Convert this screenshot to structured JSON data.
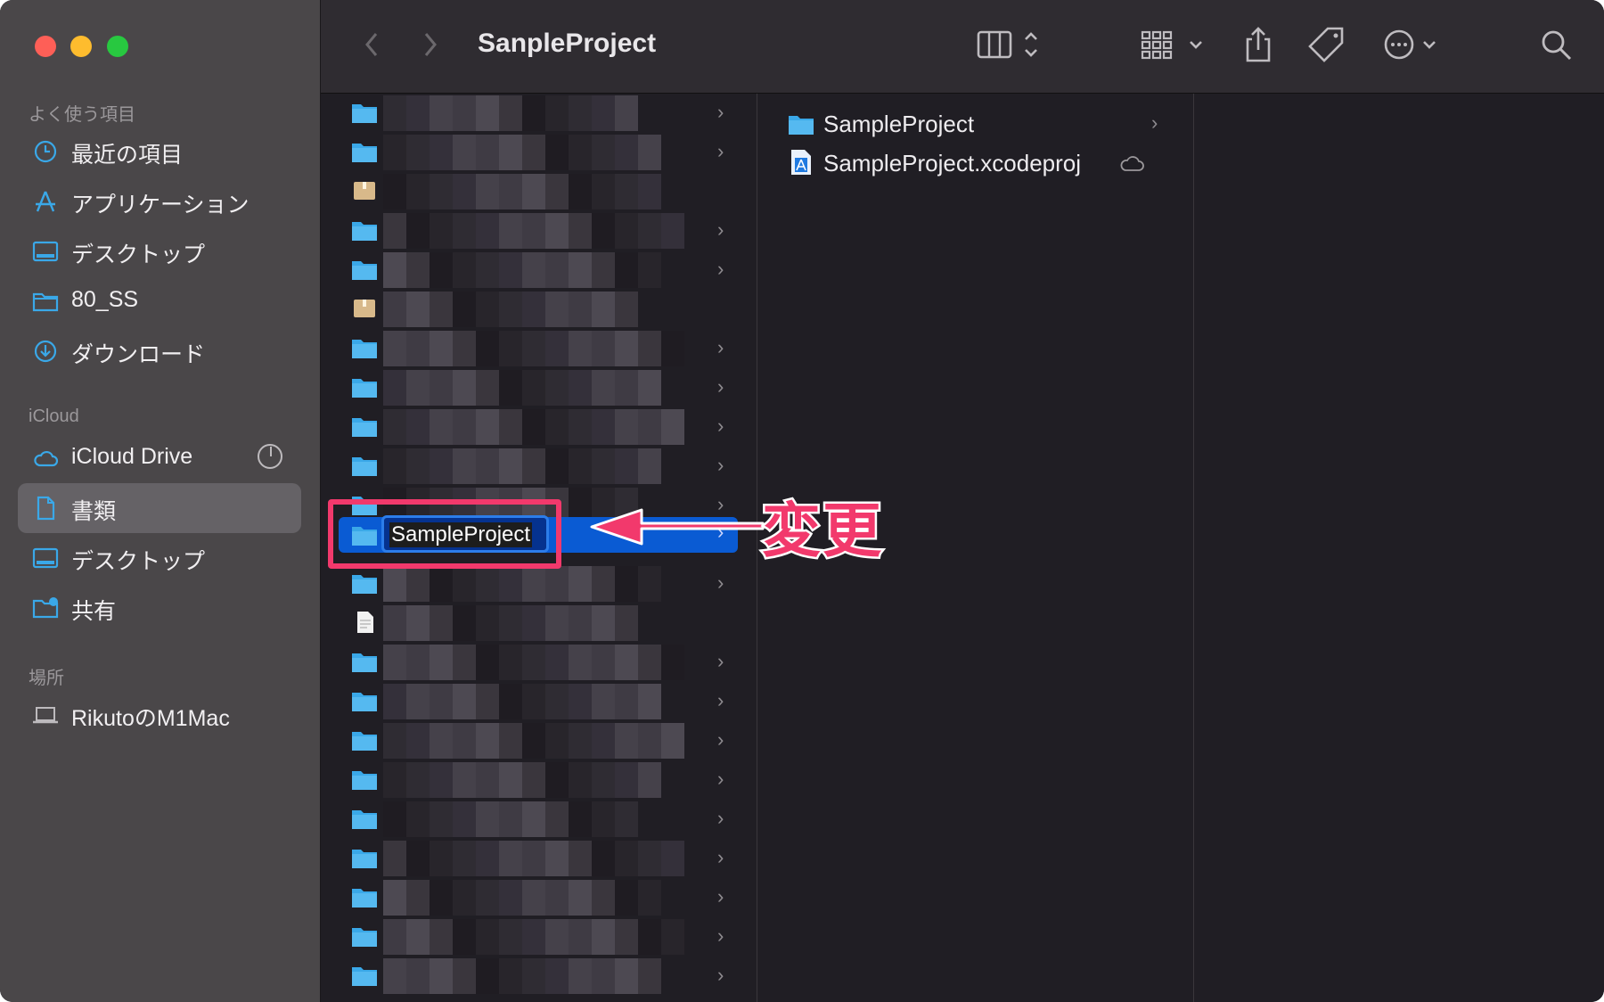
{
  "window": {
    "title": "SanpleProject"
  },
  "sidebar": {
    "favorites_title": "よく使う項目",
    "favorites": [
      {
        "label": "最近の項目",
        "icon": "clock-icon"
      },
      {
        "label": "アプリケーション",
        "icon": "applications-icon"
      },
      {
        "label": "デスクトップ",
        "icon": "desktop-icon"
      },
      {
        "label": "80_SS",
        "icon": "folder-icon"
      },
      {
        "label": "ダウンロード",
        "icon": "download-icon"
      }
    ],
    "icloud_title": "iCloud",
    "icloud": [
      {
        "label": "iCloud Drive",
        "icon": "cloud-icon"
      },
      {
        "label": "書類",
        "icon": "document-icon",
        "selected": true
      },
      {
        "label": "デスクトップ",
        "icon": "desktop-icon"
      },
      {
        "label": "共有",
        "icon": "shared-folder-icon"
      }
    ],
    "locations_title": "場所",
    "locations": [
      {
        "label": "RikutoのM1Mac",
        "icon": "laptop-icon"
      }
    ]
  },
  "toolbar": {
    "icons": [
      "back-icon",
      "forward-icon",
      "column-view-icon",
      "group-icon",
      "share-icon",
      "tag-icon",
      "more-icon",
      "search-icon"
    ]
  },
  "column1": {
    "rename_value": "SampleProject"
  },
  "column2": {
    "items": [
      {
        "label": "SampleProject",
        "icon": "folder-icon"
      },
      {
        "label": "SampleProject.xcodeproj",
        "icon": "xcodeproj-icon"
      }
    ]
  },
  "annotation": {
    "label": "変更",
    "color": "#f2396c"
  },
  "colors": {
    "accent": "#0a5bd3",
    "folder": "#3aa8e8",
    "annotation": "#f2396c"
  }
}
